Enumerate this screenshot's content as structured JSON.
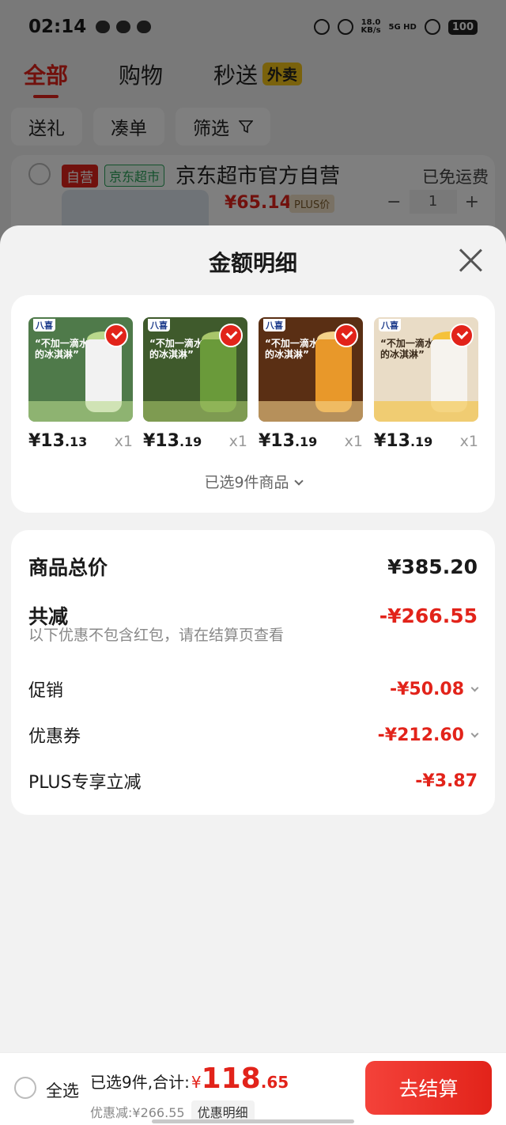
{
  "status_bar": {
    "time": "02:14",
    "net_speed_value": "18.0",
    "net_speed_unit": "KB/s",
    "signal_label": "5G HD",
    "battery": "100"
  },
  "main_tabs": [
    {
      "label": "全部",
      "active": true
    },
    {
      "label": "购物",
      "active": false
    },
    {
      "label": "秒送",
      "active": false,
      "badge": "外卖"
    }
  ],
  "filter_chips": [
    "送礼",
    "凑单",
    "筛选"
  ],
  "background_cart": {
    "tag_self": "自营",
    "tag_store": "京东超市",
    "shop_name": "京东超市官方自营",
    "shipping": "已免运费",
    "price": "¥65.14",
    "plus_tag": "PLUS价",
    "quantity": "1"
  },
  "sheet": {
    "title": "金额明细",
    "products": [
      {
        "brand": "八喜",
        "slogan": "“不加一滴水的冰淇淋”",
        "price_int": "¥13",
        "price_dec": ".13",
        "qty": "x1",
        "theme": "#4f7a4a",
        "tub": "#f2f2f2",
        "top": "#b9d88c"
      },
      {
        "brand": "八喜",
        "slogan": "“不加一滴水的冰淇淋”",
        "price_int": "¥13",
        "price_dec": ".19",
        "qty": "x1",
        "theme": "#3f5a2c",
        "tub": "#6a9a3a",
        "top": "#a8c66a"
      },
      {
        "brand": "八喜",
        "slogan": "“不加一滴水的冰淇淋”",
        "price_int": "¥13",
        "price_dec": ".19",
        "qty": "x1",
        "theme": "#5a2f14",
        "tub": "#e8982a",
        "top": "#f4d28a"
      },
      {
        "brand": "八喜",
        "slogan": "“不加一滴水的冰淇淋”",
        "price_int": "¥13",
        "price_dec": ".19",
        "qty": "x1",
        "theme": "#e9dcc6",
        "tub": "#f6f3ee",
        "top": "#f5c23a"
      }
    ],
    "selected_count_label": "已选9件商品",
    "summary": {
      "total_label": "商品总价",
      "total_value": "¥385.20",
      "reduce_label": "共减",
      "reduce_value": "-¥266.55",
      "note": "以下优惠不包含红包，请在结算页查看",
      "promo_label": "促销",
      "promo_value": "-¥50.08",
      "coupon_label": "优惠券",
      "coupon_value": "-¥212.60",
      "plus_label": "PLUS专享立减",
      "plus_value": "-¥3.87"
    }
  },
  "bottom_bar": {
    "select_all": "全选",
    "summary_prefix": "已选9件,合计:",
    "currency": "¥",
    "total_int": "118",
    "total_dec": ".65",
    "discount_text": "优惠减:¥266.55",
    "detail_button": "优惠明细",
    "checkout_button": "去结算"
  },
  "colors": {
    "accent": "#e2231a",
    "sheet_bg": "#f2f2f2"
  }
}
